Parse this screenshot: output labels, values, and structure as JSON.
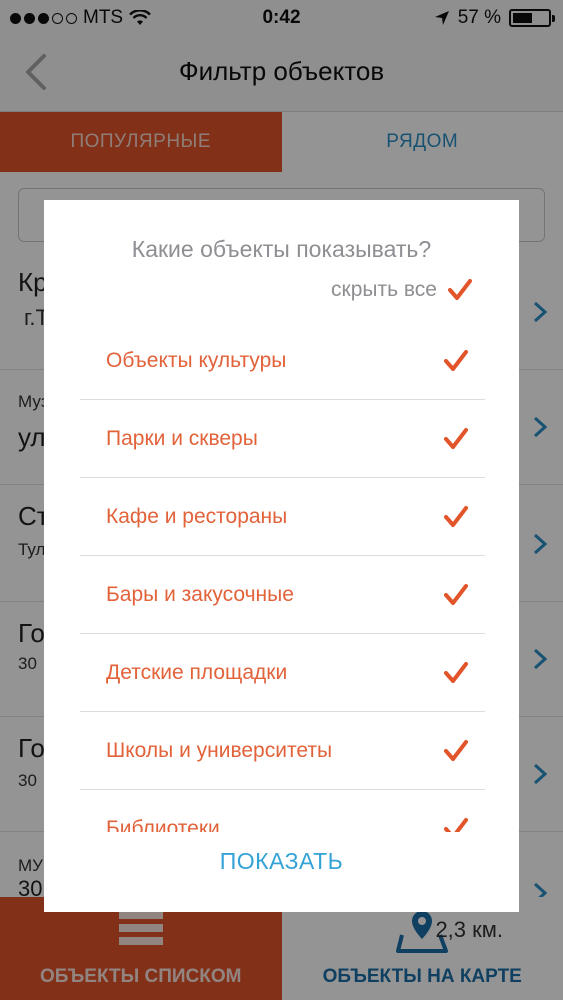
{
  "status_bar": {
    "carrier": "MTS",
    "time": "0:42",
    "battery": "57 %",
    "battery_level": 0.57
  },
  "nav": {
    "title": "Фильтр объектов"
  },
  "tabs": [
    {
      "label": "ПОПУЛЯРНЫЕ"
    },
    {
      "label": "РЯДОМ"
    }
  ],
  "background_list": [
    {
      "title": "Кр",
      "subtitle": "г.Т"
    },
    {
      "title": "ул",
      "subtitle": "Муз"
    },
    {
      "title": "Ст",
      "subtitle": "Тул"
    },
    {
      "title": "Го",
      "subtitle": "30"
    },
    {
      "title": "Го",
      "subtitle": "30"
    },
    {
      "title": "30",
      "subtitle": "МУ"
    }
  ],
  "bottom_bar": {
    "list_label": "ОБЪЕКТЫ СПИСКОМ",
    "map_label": "ОБЪЕКТЫ НА КАРТЕ",
    "distance": "2,3 км."
  },
  "modal": {
    "title": "Какие объекты показывать?",
    "hide_all_label": "скрыть все",
    "options": [
      {
        "label": "Объекты культуры",
        "checked": true
      },
      {
        "label": "Парки и скверы",
        "checked": true
      },
      {
        "label": "Кафе и рестораны",
        "checked": true
      },
      {
        "label": "Бары и закусочные",
        "checked": true
      },
      {
        "label": "Детские площадки",
        "checked": true
      },
      {
        "label": "Школы и университеты",
        "checked": true
      },
      {
        "label": "Библиотеки",
        "checked": true
      }
    ],
    "show_button": "ПОКАЗАТЬ"
  },
  "colors": {
    "accent_orange": "#e2542a",
    "option_text": "#e2623a",
    "link_blue": "#35a3d6",
    "map_blue": "#1c6fa8",
    "muted_gray": "#8e8e93"
  }
}
